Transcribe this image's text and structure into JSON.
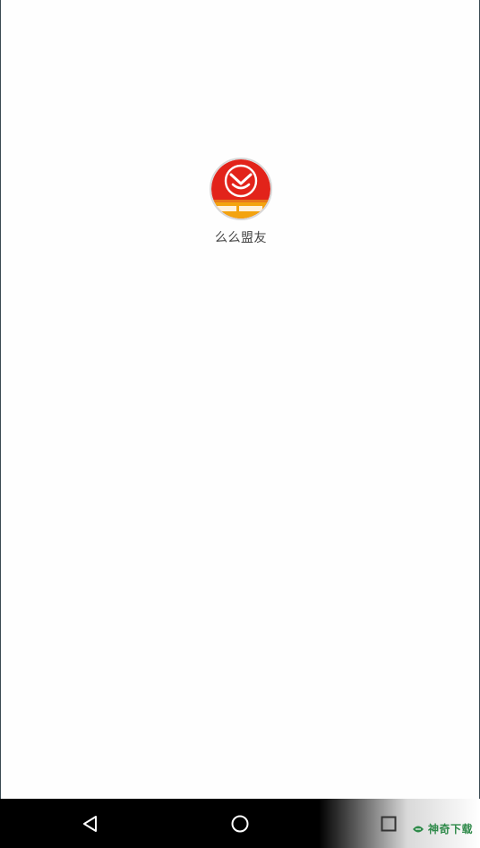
{
  "home": {
    "apps": [
      {
        "label": "么么盟友",
        "icon": "memeng-app-icon"
      }
    ]
  },
  "navigation_bar": {
    "back_icon": "back-triangle-icon",
    "home_icon": "home-circle-icon",
    "recents_icon": "recents-square-icon"
  },
  "watermark": {
    "text": "神奇下载",
    "icon": "leaf-logo-icon"
  },
  "colors": {
    "icon_red": "#e2231a",
    "icon_banner": "#f3a30f",
    "nav_background": "#000000",
    "watermark_green": "#2f8a4a"
  }
}
